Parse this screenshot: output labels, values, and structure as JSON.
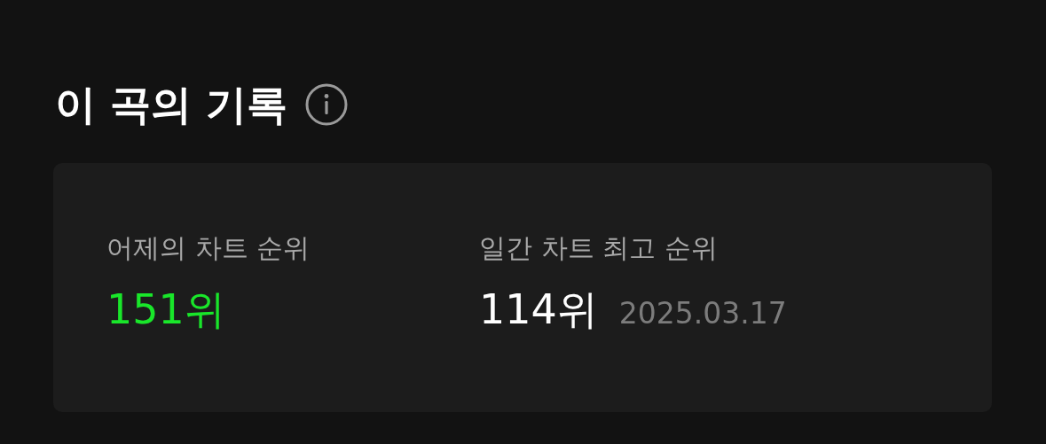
{
  "section": {
    "title": "이 곡의 기록"
  },
  "stats": [
    {
      "label": "어제의 차트 순위",
      "value": "151위",
      "color": "#19e62a"
    },
    {
      "label": "일간 차트 최고 순위",
      "value": "114위",
      "date": "2025.03.17",
      "color": "#ffffff"
    }
  ]
}
